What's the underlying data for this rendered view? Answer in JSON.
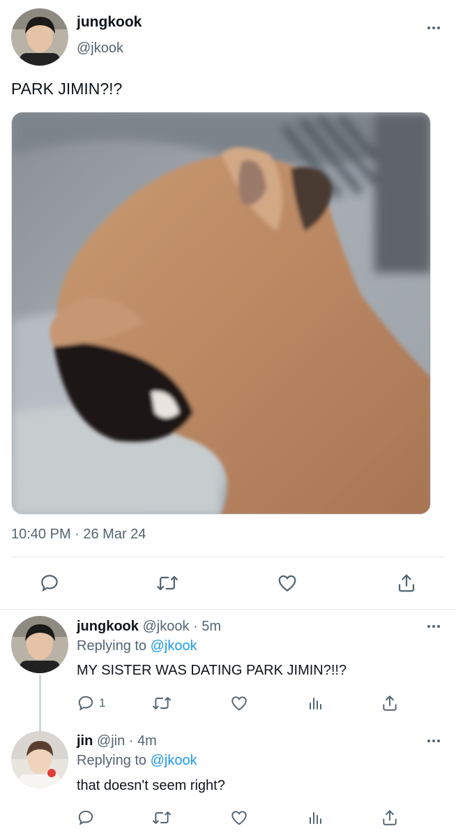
{
  "main_tweet": {
    "author_name": "jungkook",
    "author_handle": "@jkook",
    "text": "PARK JIMIN?!?",
    "timestamp": "10:40 PM · 26 Mar 24",
    "media_description": "photo-dog-yawning"
  },
  "actions": {
    "reply_icon": "reply-icon",
    "retweet_icon": "retweet-icon",
    "like_icon": "heart-icon",
    "share_icon": "share-icon",
    "analytics_icon": "analytics-icon"
  },
  "replies": [
    {
      "author_name": "jungkook",
      "author_handle": "@jkook",
      "time": "· 5m",
      "replying_prefix": "Replying to",
      "replying_to": "@jkook",
      "text": "MY SISTER WAS DATING PARK JIMIN?!!?",
      "reply_count": "1"
    },
    {
      "author_name": "jin",
      "author_handle": "@jin",
      "time": "· 4m",
      "replying_prefix": "Replying to",
      "replying_to": "@jkook",
      "text": "that doesn't seem right?",
      "reply_count": ""
    }
  ],
  "colors": {
    "link": "#1d9bf0",
    "muted": "#536471",
    "text": "#0f1419"
  }
}
